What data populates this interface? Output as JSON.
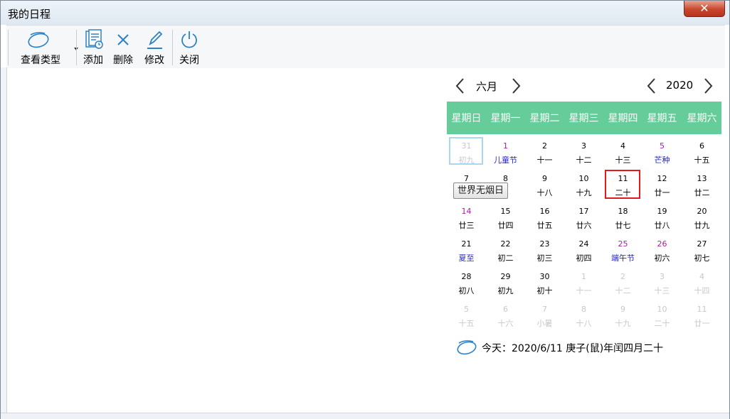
{
  "window": {
    "title": "我的日程",
    "close_glyph": "✕"
  },
  "toolbar": {
    "items": [
      {
        "label": "查看类型",
        "icon": "ellipse-view-icon"
      },
      {
        "label": "添加",
        "icon": "add-document-icon"
      },
      {
        "label": "删除",
        "icon": "x-delete-icon"
      },
      {
        "label": "修改",
        "icon": "pencil-icon"
      },
      {
        "label": "关闭",
        "icon": "power-icon"
      }
    ]
  },
  "calendar": {
    "month": "六月",
    "year": "2020",
    "weekdays": [
      "星期日",
      "星期一",
      "星期二",
      "星期三",
      "星期四",
      "星期五",
      "星期六"
    ],
    "rows": [
      [
        {
          "d": "31",
          "l": "初九",
          "other": true
        },
        {
          "d": "1",
          "l": "儿童节",
          "fest": true,
          "wk": true
        },
        {
          "d": "2",
          "l": "十一"
        },
        {
          "d": "3",
          "l": "十二"
        },
        {
          "d": "4",
          "l": "十三"
        },
        {
          "d": "5",
          "l": "芒种",
          "fest": true,
          "wk": true
        },
        {
          "d": "6",
          "l": "十五"
        }
      ],
      [
        {
          "d": "7",
          "l": ""
        },
        {
          "d": "8",
          "l": ""
        },
        {
          "d": "9",
          "l": "十八"
        },
        {
          "d": "10",
          "l": "十九"
        },
        {
          "d": "11",
          "l": "二十"
        },
        {
          "d": "12",
          "l": "廿一"
        },
        {
          "d": "13",
          "l": "廿二"
        }
      ],
      [
        {
          "d": "14",
          "l": "廿三",
          "wk": true
        },
        {
          "d": "15",
          "l": "廿四"
        },
        {
          "d": "16",
          "l": "廿五"
        },
        {
          "d": "17",
          "l": "廿六"
        },
        {
          "d": "18",
          "l": "廿七"
        },
        {
          "d": "19",
          "l": "廿八"
        },
        {
          "d": "20",
          "l": "廿九"
        }
      ],
      [
        {
          "d": "21",
          "l": "夏至",
          "fest": true
        },
        {
          "d": "22",
          "l": "初二"
        },
        {
          "d": "23",
          "l": "初三"
        },
        {
          "d": "24",
          "l": "初四"
        },
        {
          "d": "25",
          "l": "端午节",
          "fest": true,
          "wk": true
        },
        {
          "d": "26",
          "l": "初六",
          "wk": true
        },
        {
          "d": "27",
          "l": "初七"
        }
      ],
      [
        {
          "d": "28",
          "l": "初八"
        },
        {
          "d": "29",
          "l": "初九"
        },
        {
          "d": "30",
          "l": "初十"
        },
        {
          "d": "1",
          "l": "十一",
          "other": true
        },
        {
          "d": "2",
          "l": "十二",
          "other": true
        },
        {
          "d": "3",
          "l": "十三",
          "other": true
        },
        {
          "d": "4",
          "l": "十四",
          "other": true
        }
      ],
      [
        {
          "d": "5",
          "l": "十五",
          "other": true
        },
        {
          "d": "6",
          "l": "十六",
          "other": true
        },
        {
          "d": "7",
          "l": "小暑",
          "other": true
        },
        {
          "d": "8",
          "l": "十八",
          "other": true
        },
        {
          "d": "9",
          "l": "十九",
          "other": true
        },
        {
          "d": "10",
          "l": "二十",
          "other": true
        },
        {
          "d": "11",
          "l": "廿一",
          "other": true
        }
      ]
    ],
    "tooltip": "世界无烟日",
    "today_text": "今天：2020/6/11   庚子(鼠)年闰四月二十"
  },
  "colors": {
    "header_bg": "#66cc99",
    "today_border": "#e11b1b",
    "weekend_text": "#a0239a",
    "festival_text": "#2323c0"
  }
}
